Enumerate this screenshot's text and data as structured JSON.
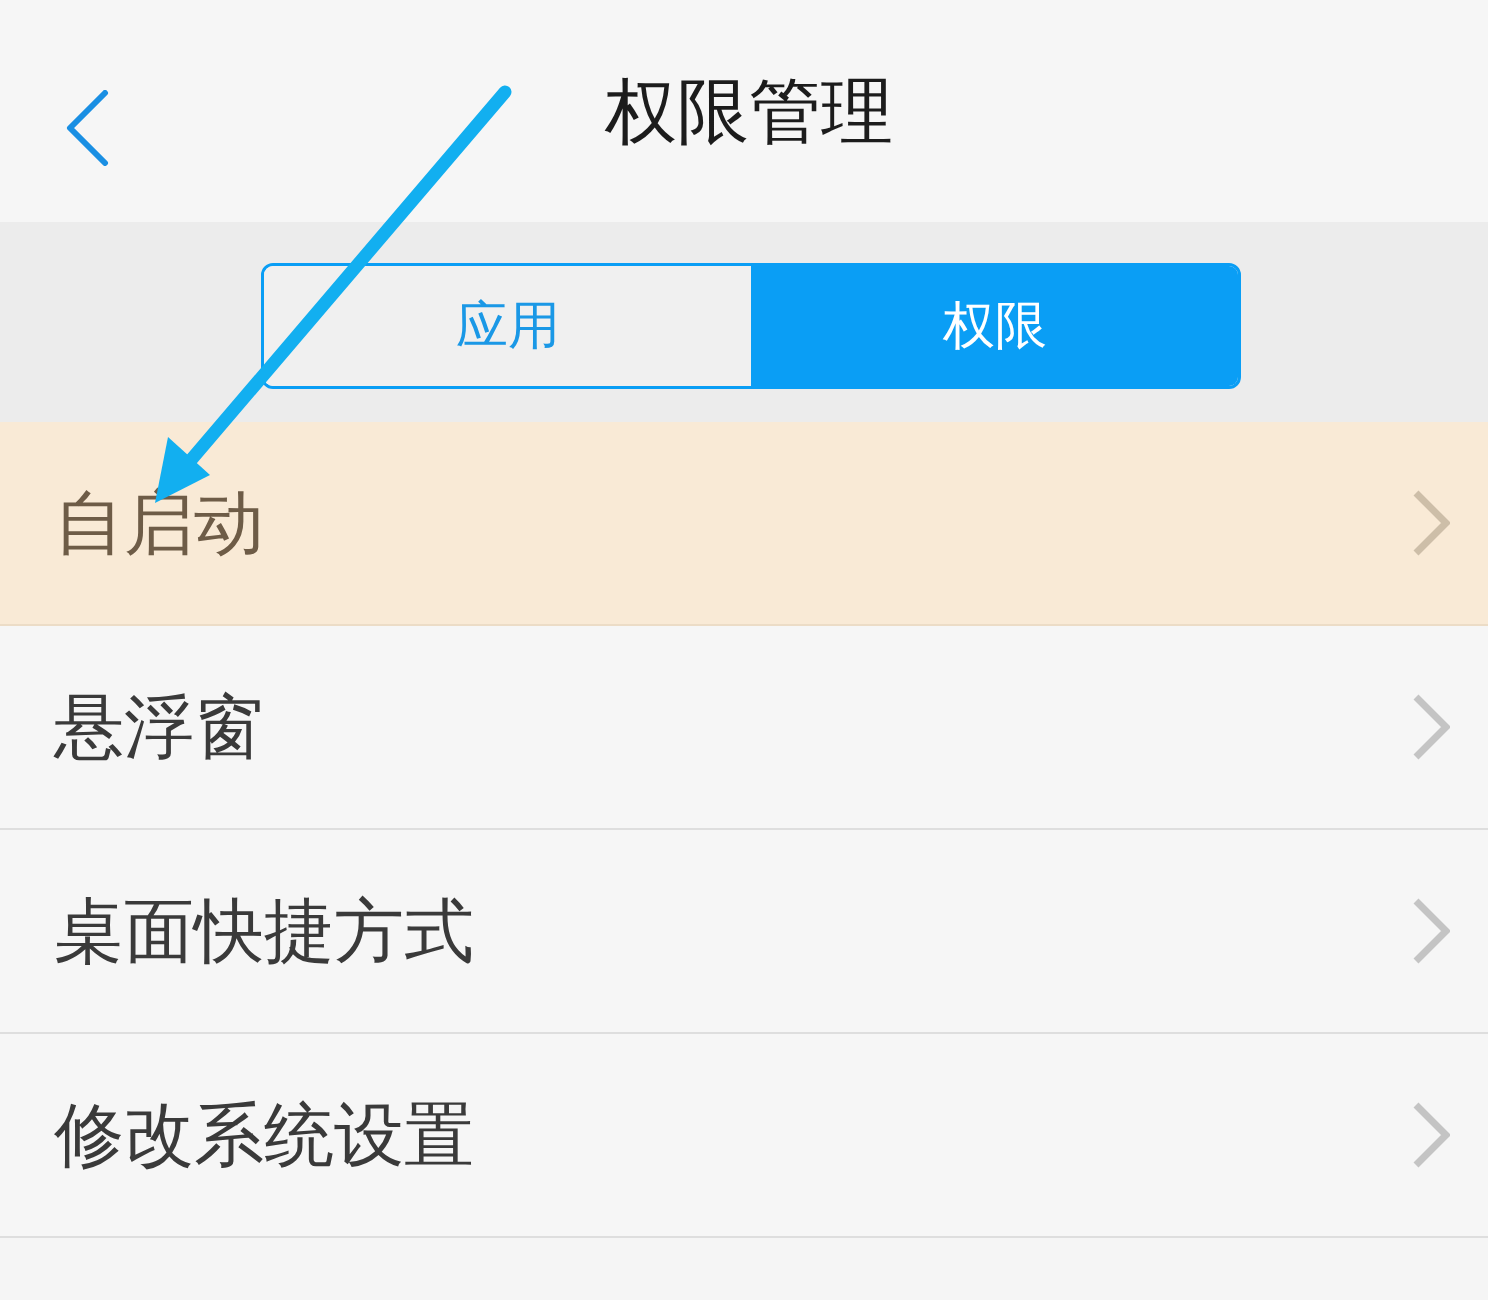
{
  "header": {
    "title": "权限管理"
  },
  "segments": [
    {
      "label": "应用",
      "selected": false
    },
    {
      "label": "权限",
      "selected": true
    }
  ],
  "rows": [
    {
      "label": "自启动",
      "highlighted": true
    },
    {
      "label": "悬浮窗",
      "highlighted": false
    },
    {
      "label": "桌面快捷方式",
      "highlighted": false
    },
    {
      "label": "修改系统设置",
      "highlighted": false
    }
  ]
}
